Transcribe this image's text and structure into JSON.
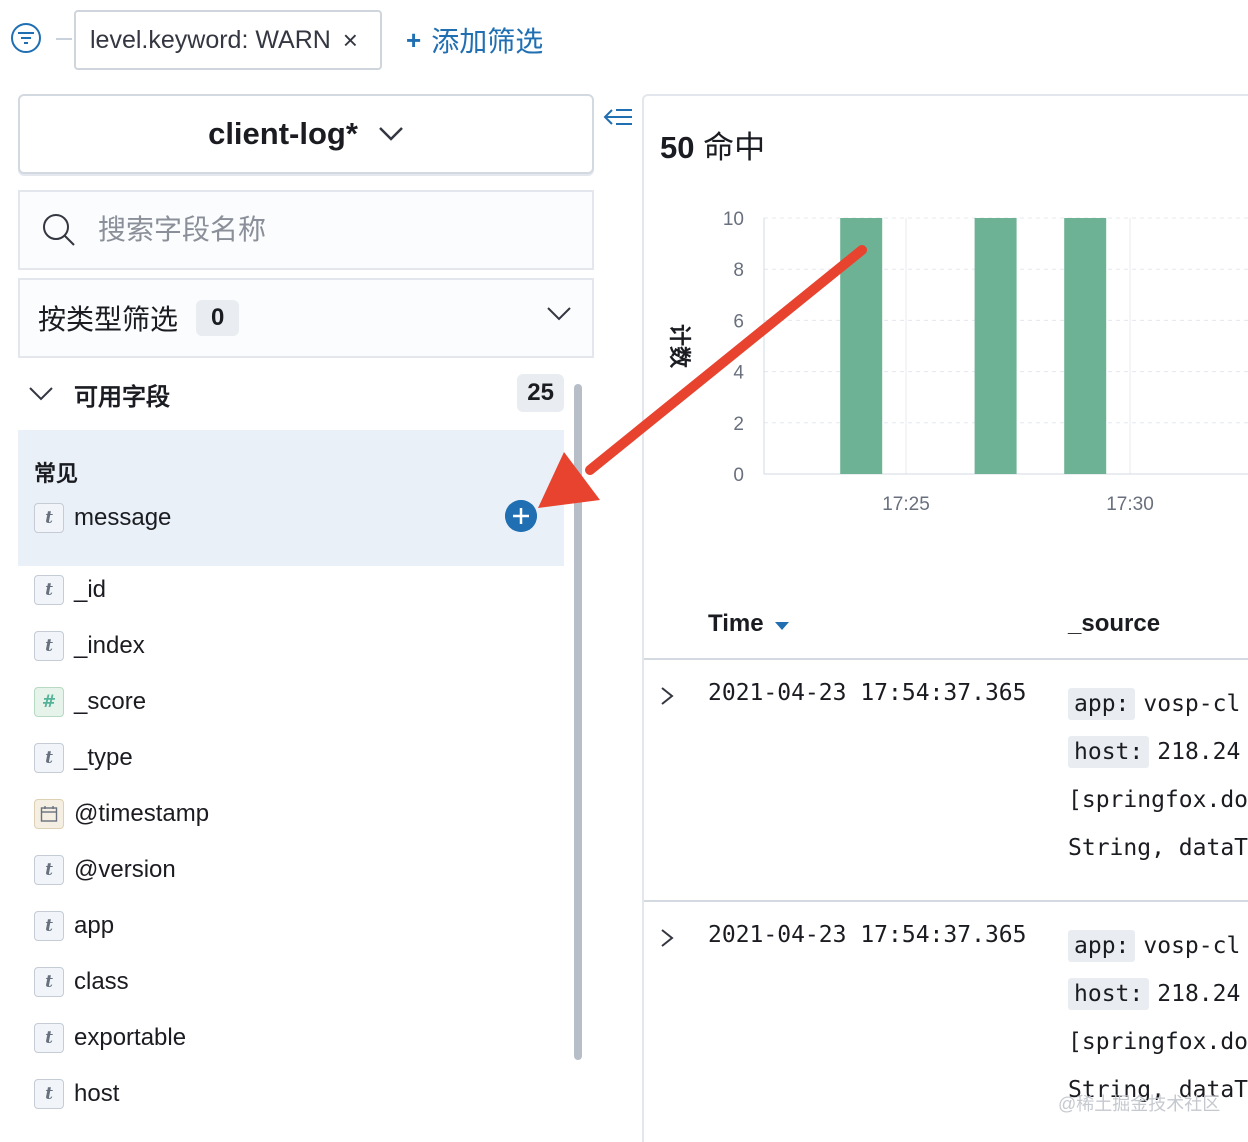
{
  "filter_bar": {
    "pill_label": "level.keyword: WARN",
    "add_filter_label": "添加筛选"
  },
  "sidebar": {
    "index_pattern": "client-log*",
    "search_placeholder": "搜索字段名称",
    "type_filter_label": "按类型筛选",
    "type_filter_count": "0",
    "available_label": "可用字段",
    "available_count": "25",
    "common_label": "常见",
    "common_fields": [
      {
        "name": "message",
        "type": "t"
      }
    ],
    "fields": [
      {
        "name": "_id",
        "type": "t"
      },
      {
        "name": "_index",
        "type": "t"
      },
      {
        "name": "_score",
        "type": "#"
      },
      {
        "name": "_type",
        "type": "t"
      },
      {
        "name": "@timestamp",
        "type": "date"
      },
      {
        "name": "@version",
        "type": "t"
      },
      {
        "name": "app",
        "type": "t"
      },
      {
        "name": "class",
        "type": "t"
      },
      {
        "name": "exportable",
        "type": "t"
      },
      {
        "name": "host",
        "type": "t"
      }
    ]
  },
  "main": {
    "hits_count": "50",
    "hits_label": "命中",
    "table": {
      "col_time": "Time",
      "col_source": "_source"
    },
    "rows": [
      {
        "time": "2021-04-23 17:54:37.365",
        "src_key1": "app:",
        "src_val1": "vosp-cl",
        "src_key2": "host:",
        "src_val2": "218.24",
        "src_line3": "[springfox.do",
        "src_line4": "String, dataT"
      },
      {
        "time": "2021-04-23 17:54:37.365",
        "src_key1": "app:",
        "src_val1": "vosp-cl",
        "src_key2": "host:",
        "src_val2": "218.24",
        "src_line3": "[springfox.do",
        "src_line4": "String, dataT"
      }
    ]
  },
  "chart_data": {
    "type": "bar",
    "ylabel": "计数",
    "ylim": [
      0,
      10
    ],
    "yticks": [
      0,
      2,
      4,
      6,
      8,
      10
    ],
    "xticks": [
      "17:25",
      "17:30"
    ],
    "bars": [
      {
        "x": "17:24",
        "value": 10
      },
      {
        "x": "17:27",
        "value": 10
      },
      {
        "x": "17:29",
        "value": 10
      }
    ],
    "bar_color": "#6db295"
  },
  "watermark": "@稀土掘金技术社区",
  "colors": {
    "accent": "#1f6fb2",
    "arrow": "#e8432f"
  }
}
